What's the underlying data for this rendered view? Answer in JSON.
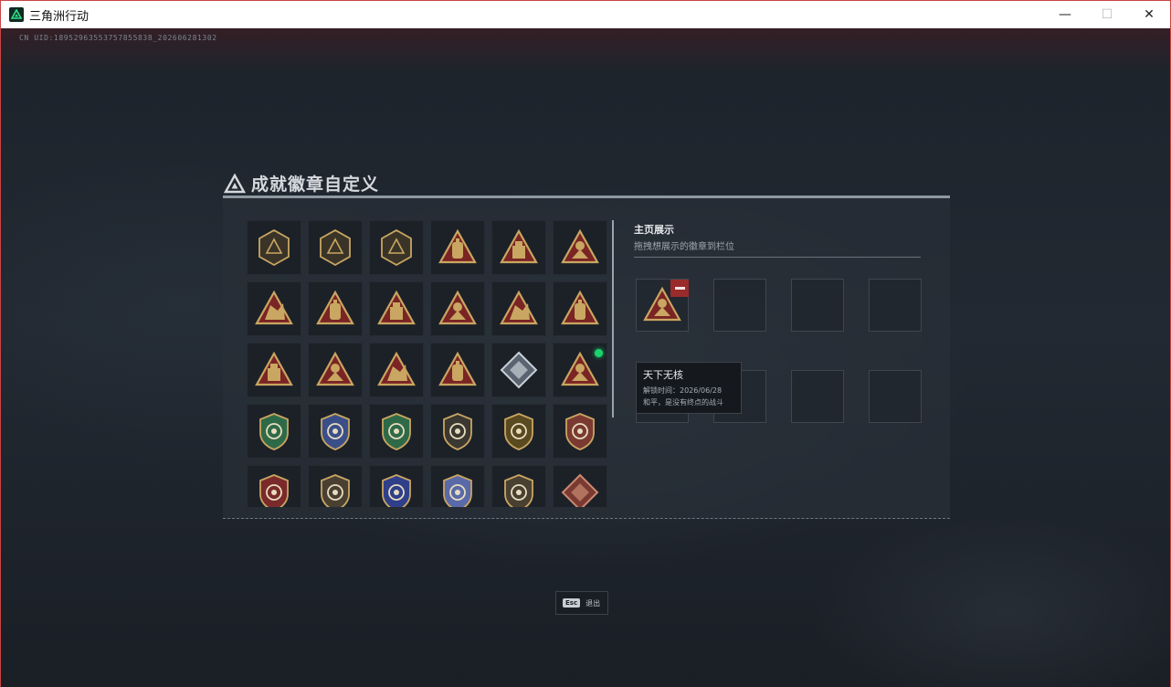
{
  "window": {
    "title": "三角洲行动",
    "minimize_icon": "—",
    "maximize_icon": "☐",
    "close_icon": "✕"
  },
  "uid_text": "CN UID:18952963553757855838_202606281302",
  "panel": {
    "title": "成就徽章自定义",
    "display_title": "主页展示",
    "display_subtitle": "拖拽想展示的徽章到栏位"
  },
  "badges": [
    {
      "icon": "triangle-emblem-badge-icon",
      "style": "dark"
    },
    {
      "icon": "helicopter-badge-icon",
      "style": "dark"
    },
    {
      "icon": "shield-arrow-badge-icon",
      "style": "dark"
    },
    {
      "icon": "vest-56-badge-icon",
      "style": "tri"
    },
    {
      "icon": "backpack-badge-icon",
      "style": "tri"
    },
    {
      "icon": "case-badge-icon",
      "style": "tri"
    },
    {
      "icon": "drone-badge-icon",
      "style": "tri"
    },
    {
      "icon": "hand-sign-badge-icon",
      "style": "tri"
    },
    {
      "icon": "trophy-badge-icon",
      "style": "tri"
    },
    {
      "icon": "helmet-badge-icon",
      "style": "tri"
    },
    {
      "icon": "runner-badge-icon",
      "style": "tri"
    },
    {
      "icon": "number-one-badge-icon",
      "style": "tri"
    },
    {
      "icon": "supply-box-badge-icon",
      "style": "tri"
    },
    {
      "icon": "soldier-badge-icon",
      "style": "tri"
    },
    {
      "icon": "squad-badge-icon",
      "style": "tri"
    },
    {
      "icon": "team-badge-icon",
      "style": "tri"
    },
    {
      "icon": "silver-cube-badge-icon",
      "style": "diamond"
    },
    {
      "icon": "fire-extinguisher-badge-icon",
      "style": "tri",
      "new": true
    },
    {
      "icon": "star-medal-badge-icon",
      "style": "round"
    },
    {
      "icon": "chevron-shield-badge-icon",
      "style": "round"
    },
    {
      "icon": "stars-shield-badge-icon",
      "style": "round"
    },
    {
      "icon": "blue-shield-badge-icon",
      "style": "round"
    },
    {
      "icon": "bronze-coin-badge-icon",
      "style": "round"
    },
    {
      "icon": "skull-target-badge-icon",
      "style": "round"
    },
    {
      "icon": "green-wreath-badge-icon",
      "style": "round"
    },
    {
      "icon": "blue-cross-badge-icon",
      "style": "round"
    },
    {
      "icon": "green-rifle-badge-icon",
      "style": "round"
    },
    {
      "icon": "dark-shield-badge-icon",
      "style": "round"
    },
    {
      "icon": "gold-wings-badge-icon",
      "style": "round"
    },
    {
      "icon": "red-diamond-badge-icon",
      "style": "diamond"
    }
  ],
  "slots": [
    {
      "filled": true,
      "icon": "fire-extinguisher-badge-icon"
    },
    {
      "filled": false
    },
    {
      "filled": false
    },
    {
      "filled": false
    },
    {
      "filled": false
    },
    {
      "filled": false
    },
    {
      "filled": false
    },
    {
      "filled": false
    }
  ],
  "tooltip": {
    "name": "天下无核",
    "unlock_time": "解锁时间：2026/06/28",
    "description": "和平，是没有终点的战斗"
  },
  "footer": {
    "esc_key": "Esc",
    "esc_label": "退出"
  },
  "colors": {
    "gold": "#c9a661",
    "dark_red": "#7a2424",
    "accent_green": "#19d56b",
    "remove_red": "#9a2b2b"
  }
}
